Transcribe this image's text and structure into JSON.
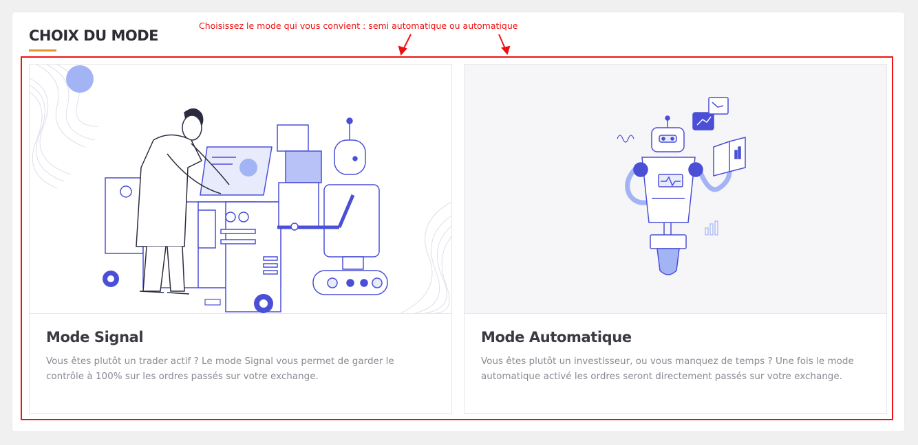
{
  "section": {
    "title": "CHOIX DU MODE"
  },
  "annotation": {
    "text": "Choisissez le mode qui vous convient : semi automatique ou automatique",
    "color": "#ee1111"
  },
  "cards": [
    {
      "title": "Mode Signal",
      "description": "Vous êtes plutôt un trader actif ? Le mode Signal vous permet de garder le contrôle à 100% sur les ordres passés sur votre exchange.",
      "illustration": "scientist-robot-illustration"
    },
    {
      "title": "Mode Automatique",
      "description": "Vous êtes plutôt un investisseur, ou vous manquez de temps ? Une fois le mode automatique activé les ordres seront directement passés sur votre exchange.",
      "illustration": "robot-trading-illustration"
    }
  ],
  "colors": {
    "accent": "#e0952a",
    "illustration_primary": "#4a4fd6",
    "illustration_secondary": "#a3b4f5",
    "background": "#f0f0f0"
  }
}
